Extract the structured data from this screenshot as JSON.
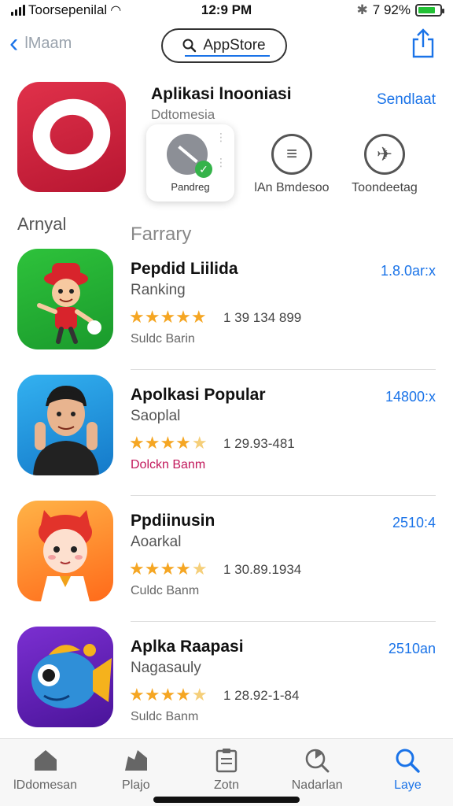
{
  "status_bar": {
    "carrier": "Toorsepenilal",
    "time": "12:9 PM",
    "battery_percent": "7 92%",
    "battery_level": 0.8
  },
  "nav": {
    "back_label": "lMaam",
    "search_label": "AppStore"
  },
  "featured": {
    "title": "Aplikasi lnooniasi",
    "subtitle": "Ddtomesia",
    "link": "Sendlaat",
    "quick": [
      {
        "label": "Pandreg",
        "icon": "tools-icon"
      },
      {
        "label": "lAn Bmdesoo",
        "icon": "list-icon"
      },
      {
        "label": "Toondeetag",
        "icon": "airplane-icon"
      }
    ]
  },
  "sections": {
    "left": "Arnyal",
    "right": "Farrary"
  },
  "apps": [
    {
      "name": "Pepdid Liilida",
      "category": "Ranking",
      "rating": 5,
      "count": "1 39 134 899",
      "developer": "Suldc Barin",
      "price": "1.8.0ar:x",
      "icon": "cartoon-boy-red-hat-icon",
      "colors": [
        "#2ec23b",
        "#1a9a2c"
      ]
    },
    {
      "name": "Apolkasi Popular",
      "category": "Saoplal",
      "rating": 4.5,
      "count": "1 29.93-481",
      "developer": "Dolckn Banm",
      "price": "14800:x",
      "icon": "man-avatar-icon",
      "colors": [
        "#33b1f0",
        "#1479c9"
      ]
    },
    {
      "name": "Ppdiinusin",
      "category": "Aoarkal",
      "rating": 4.5,
      "count": "1 30.89.1934",
      "developer": "Culdc Banm",
      "price": "2510:4",
      "icon": "cat-girl-icon",
      "colors": [
        "#ffb347",
        "#ff6a1a"
      ]
    },
    {
      "name": "Aplka Raapasi",
      "category": "Nagasauly",
      "rating": 4.5,
      "count": "1 28.92-1-84",
      "developer": "Suldc Banm",
      "price": "2510an",
      "icon": "fish-icon",
      "colors": [
        "#7b2fd1",
        "#4a149a"
      ]
    }
  ],
  "tabs": [
    {
      "label": "lDdomesan",
      "icon": "home-icon",
      "active": false
    },
    {
      "label": "Plajo",
      "icon": "games-icon",
      "active": false
    },
    {
      "label": "Zotn",
      "icon": "clipboard-icon",
      "active": false
    },
    {
      "label": "Nadarlan",
      "icon": "radar-icon",
      "active": false
    },
    {
      "label": "Laye",
      "icon": "search-icon",
      "active": true
    }
  ]
}
